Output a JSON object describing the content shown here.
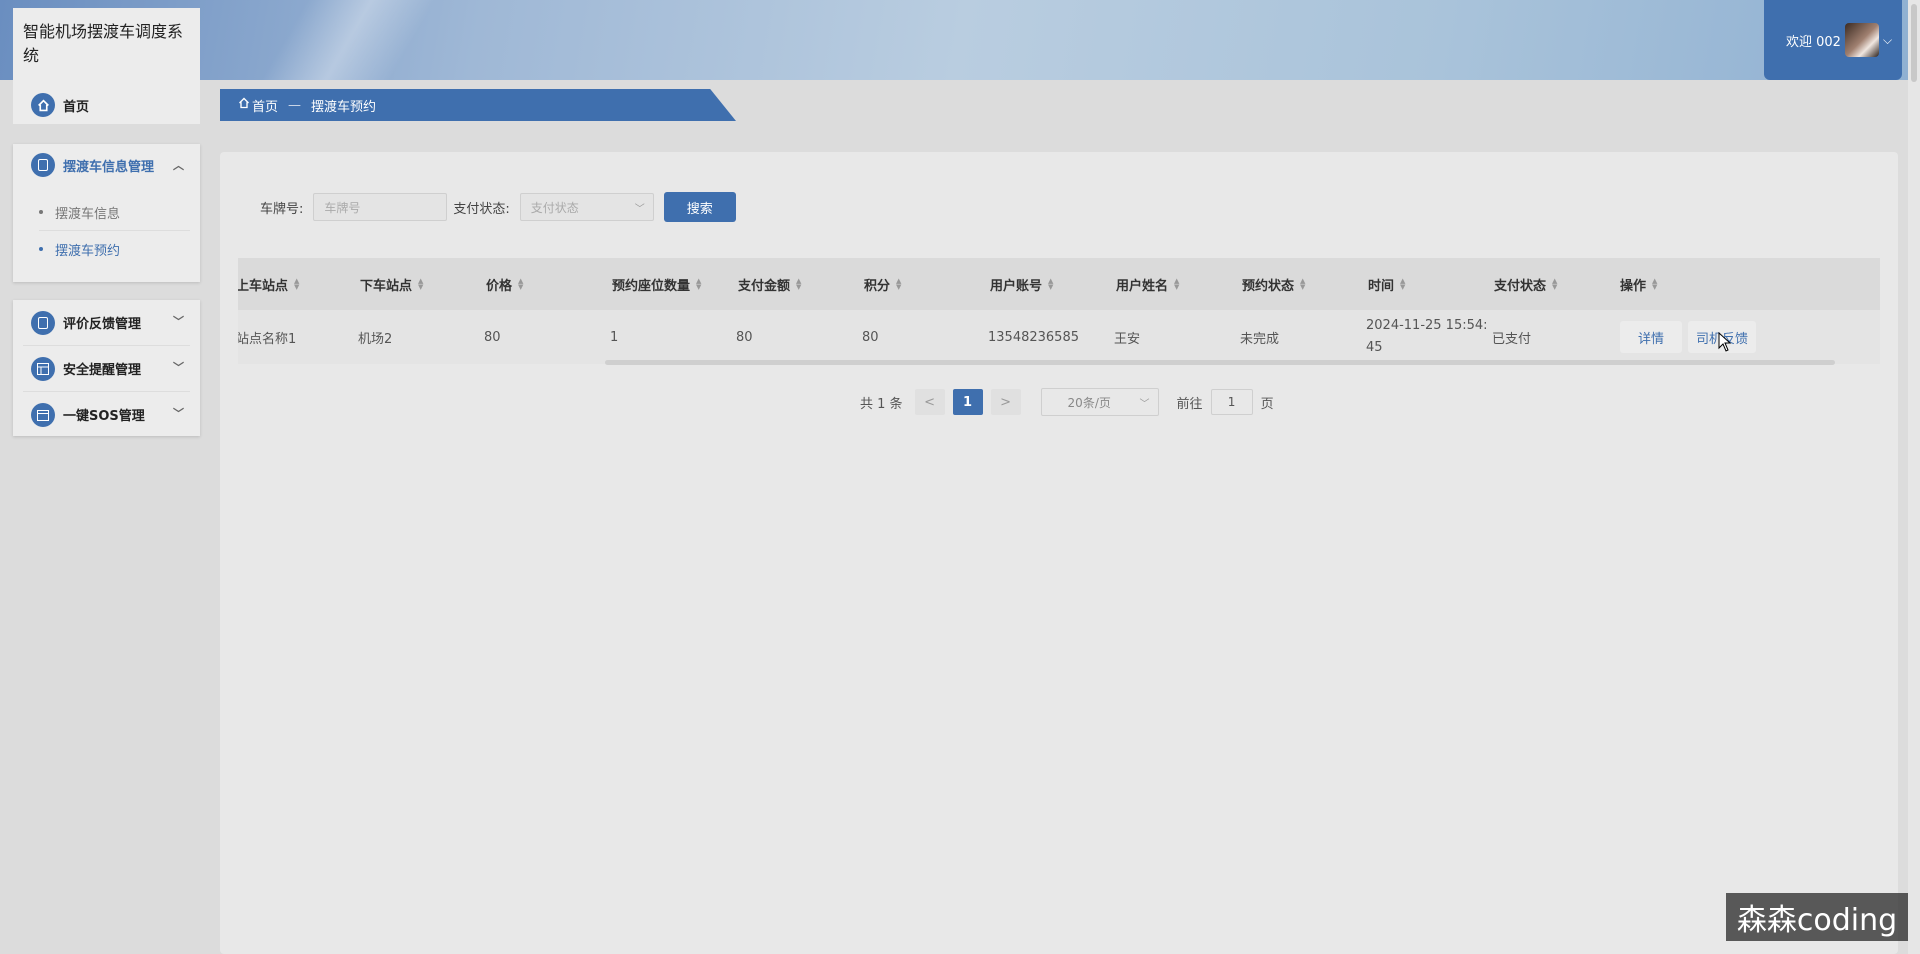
{
  "app": {
    "title": "智能机场摆渡车调度系统"
  },
  "header": {
    "welcome": "欢迎 002",
    "user_chevron": "⌵"
  },
  "sidebar": {
    "home_label": "首页",
    "groups": [
      {
        "label": "摆渡车信息管理",
        "expanded": true,
        "items": [
          {
            "label": "摆渡车信息",
            "active": false
          },
          {
            "label": "摆渡车预约",
            "active": true
          }
        ]
      },
      {
        "label": "评价反馈管理",
        "expanded": false
      },
      {
        "label": "安全提醒管理",
        "expanded": false
      },
      {
        "label": "一键SOS管理",
        "expanded": false
      }
    ]
  },
  "breadcrumb": {
    "home": "首页",
    "separator": "—",
    "current": "摆渡车预约"
  },
  "search": {
    "plate_label": "车牌号:",
    "plate_placeholder": "车牌号",
    "pay_label": "支付状态:",
    "pay_placeholder": "支付状态",
    "search_button": "搜索"
  },
  "table": {
    "columns": [
      "上车站点",
      "下车站点",
      "价格",
      "预约座位数量",
      "支付金额",
      "积分",
      "用户账号",
      "用户姓名",
      "预约状态",
      "时间",
      "支付状态",
      "操作"
    ],
    "rows": [
      {
        "pickup": "站点名称1",
        "dropoff": "机场2",
        "price": "80",
        "seats": "1",
        "amount": "80",
        "points": "80",
        "account": "13548236585",
        "name": "王安",
        "status": "未完成",
        "time_line1": "2024-11-25 15:54:",
        "time_line2": "45",
        "pay_status": "已支付",
        "actions": [
          "详情",
          "司机反馈"
        ]
      }
    ]
  },
  "pagination": {
    "total": "共 1 条",
    "prev": "<",
    "current": "1",
    "next": ">",
    "page_size": "20条/页",
    "goto_label": "前往",
    "goto_value": "1",
    "page_suffix": "页"
  },
  "watermark": "森森coding",
  "colors": {
    "primary": "#3f6fae",
    "background": "#dcdcdc",
    "panel": "#e8e8e8"
  }
}
